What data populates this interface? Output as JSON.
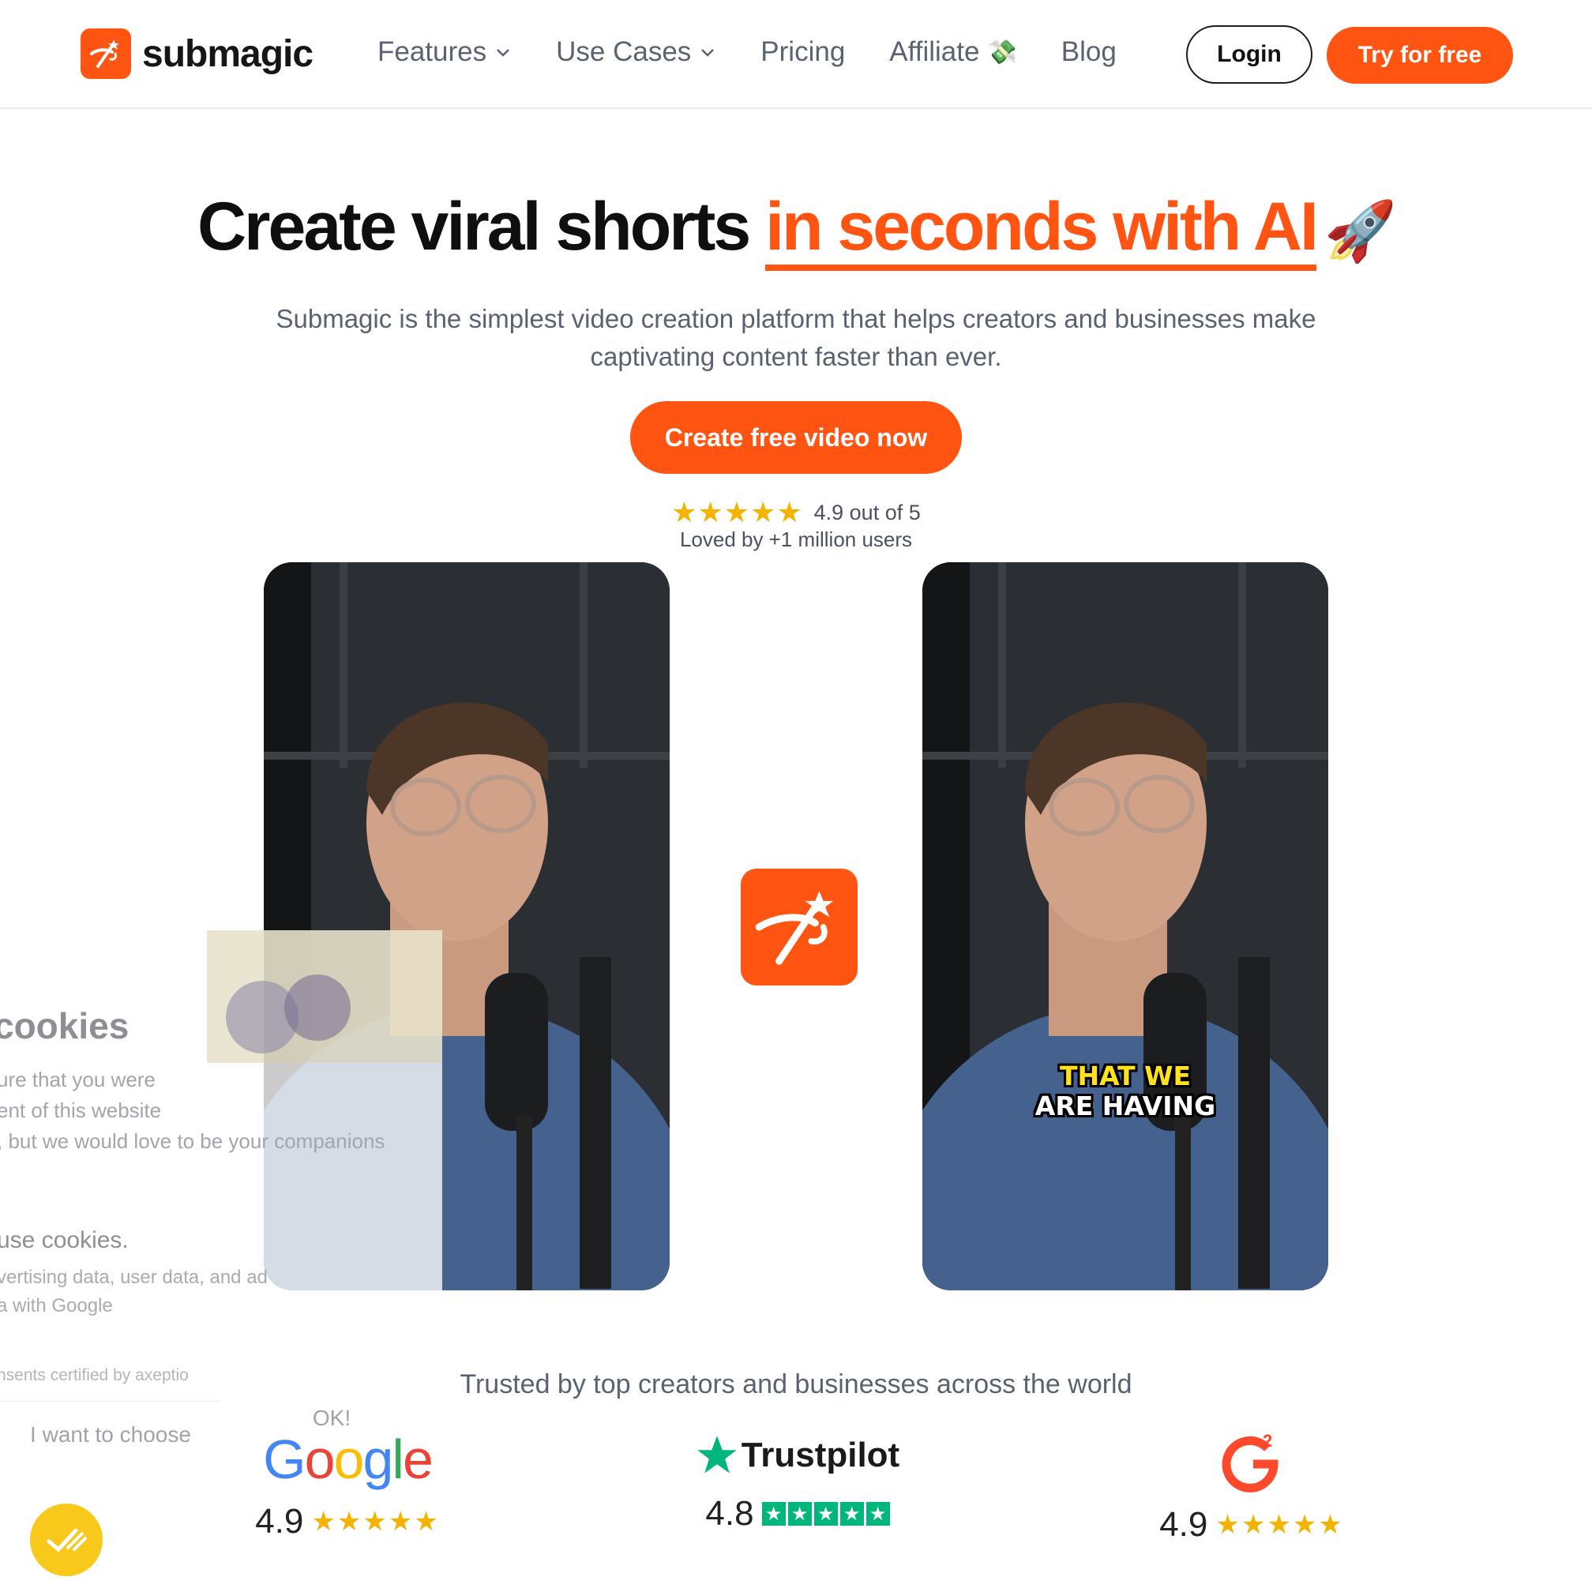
{
  "brand": {
    "name": "submagic",
    "color": "#ff5412"
  },
  "nav": {
    "items": [
      {
        "label": "Features",
        "has_dropdown": true
      },
      {
        "label": "Use Cases",
        "has_dropdown": true
      },
      {
        "label": "Pricing",
        "has_dropdown": false
      },
      {
        "label": "Affiliate",
        "has_dropdown": false,
        "icon": "money-icon"
      },
      {
        "label": "Blog",
        "has_dropdown": false
      }
    ],
    "login_label": "Login",
    "try_label": "Try for free"
  },
  "hero": {
    "title_plain": "Create viral shorts",
    "title_accent": "in seconds with AI",
    "title_emoji": "🚀",
    "subtitle": "Submagic is the simplest video creation platform that helps creators and businesses make captivating content faster than ever.",
    "cta_label": "Create free video now",
    "rating_stars": "★★★★★",
    "rating_text": "4.9 out of 5",
    "loved_text": "Loved by +1 million users"
  },
  "videos": {
    "caption_line1": "THAT WE",
    "caption_line2": "ARE HAVING"
  },
  "cookie_banner": {
    "title": "cookies",
    "text": "ure that you were\nent of this website\n, but we would love to be your companions",
    "heading2": "use cookies.",
    "text2": "vertising data, user data, and ad\na with Google",
    "certified": "nsents certified by  axeptio",
    "choose_label": "I want to choose",
    "ok_label": "OK!"
  },
  "trust": {
    "heading": "Trusted by top creators and businesses across the world",
    "google": {
      "name": "Google",
      "score": "4.9",
      "stars": "★★★★★"
    },
    "trustpilot": {
      "name": "Trustpilot",
      "score": "4.8"
    },
    "g2": {
      "score": "4.9",
      "stars": "★★★★★"
    }
  }
}
